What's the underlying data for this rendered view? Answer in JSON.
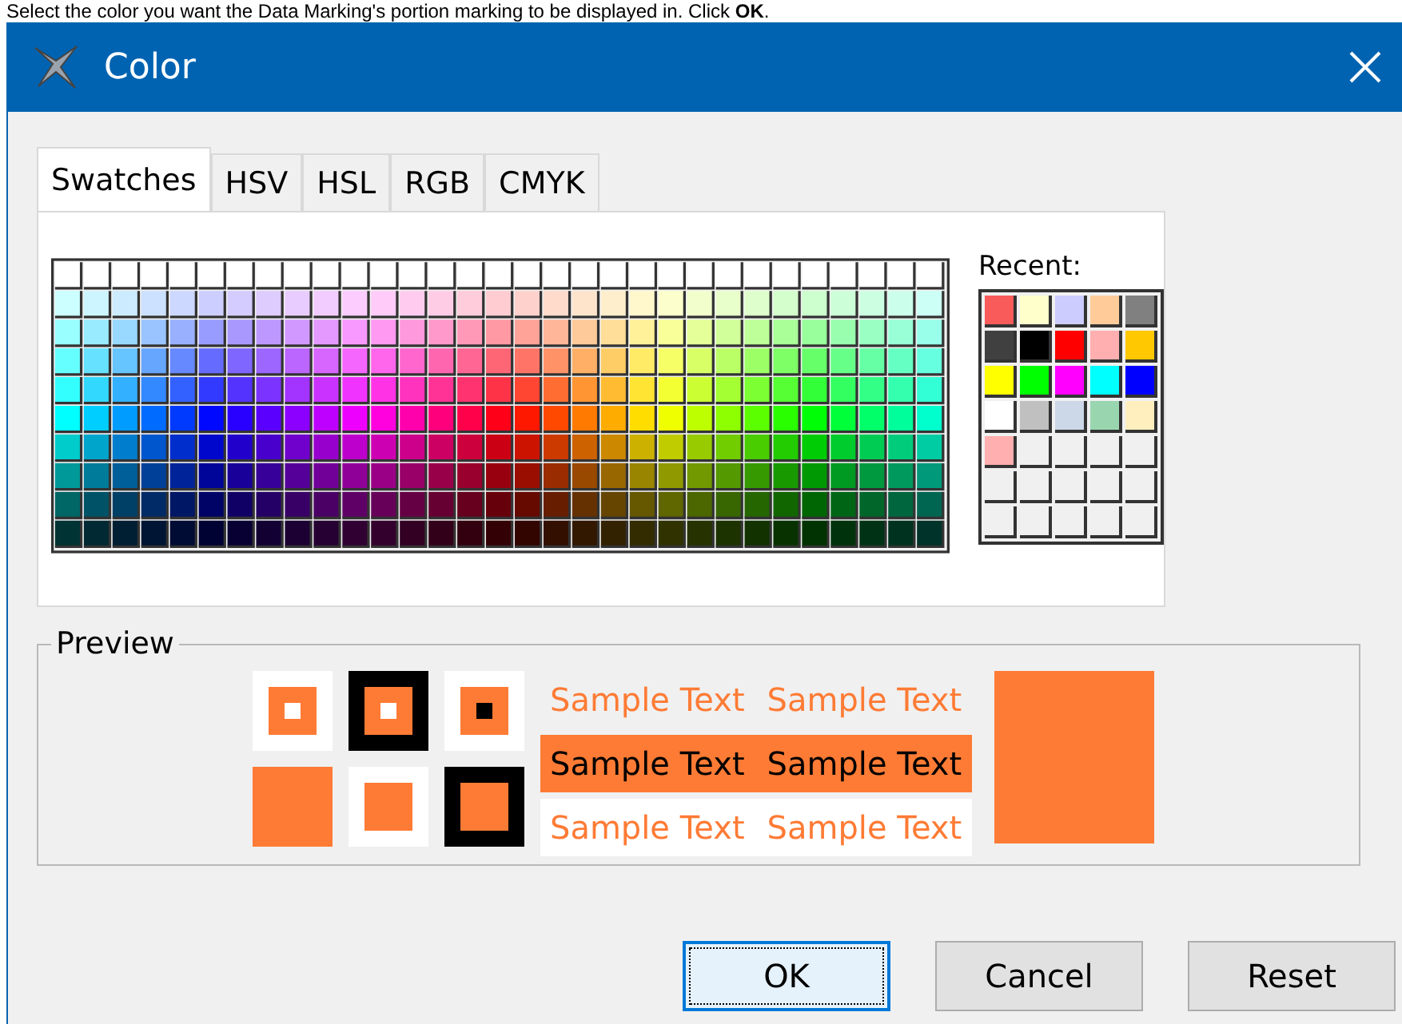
{
  "instruction": "Select the color you want the Data Marking's portion marking to be displayed in. Click **OK**.",
  "window": {
    "title": "Color"
  },
  "tabs": [
    {
      "label": "Swatches",
      "selected": true
    },
    {
      "label": "HSV",
      "selected": false
    },
    {
      "label": "HSL",
      "selected": false
    },
    {
      "label": "RGB",
      "selected": false
    },
    {
      "label": "CMYK",
      "selected": false
    }
  ],
  "recent": {
    "label": "Recent:",
    "colors": [
      {
        "color": "#f95b5b"
      },
      {
        "color": "#ffffcc"
      },
      {
        "color": "#ccccff"
      },
      {
        "color": "#ffcc99"
      },
      {
        "color": "#808080"
      },
      {
        "color": "#404040"
      },
      {
        "color": "#000000"
      },
      {
        "color": "#ff0000"
      },
      {
        "color": "#ffafaf"
      },
      {
        "color": "#ffc800"
      },
      {
        "color": "#ffff00"
      },
      {
        "color": "#00ff00"
      },
      {
        "color": "#ff00ff"
      },
      {
        "color": "#00ffff"
      },
      {
        "color": "#0000ff"
      },
      {
        "color": "#ffffff"
      },
      {
        "color": "#c0c0c0"
      },
      {
        "color": "#ccd8e8"
      },
      {
        "color": "#99d6b0"
      },
      {
        "color": "#ffefbf"
      },
      {
        "color": "#ffafaf"
      }
    ]
  },
  "preview": {
    "title": "Preview",
    "color": "#fe7b35",
    "sample_rows": [
      {
        "kind": "plain",
        "texts": [
          "Sample Text",
          "Sample Text"
        ]
      },
      {
        "kind": "inverse",
        "texts": [
          "Sample Text",
          "Sample Text"
        ]
      },
      {
        "kind": "white",
        "texts": [
          "Sample Text",
          "Sample Text"
        ]
      }
    ]
  },
  "buttons": [
    {
      "label": "OK",
      "focused": true
    },
    {
      "label": "Cancel",
      "focused": false
    },
    {
      "label": "Reset",
      "focused": false
    }
  ]
}
